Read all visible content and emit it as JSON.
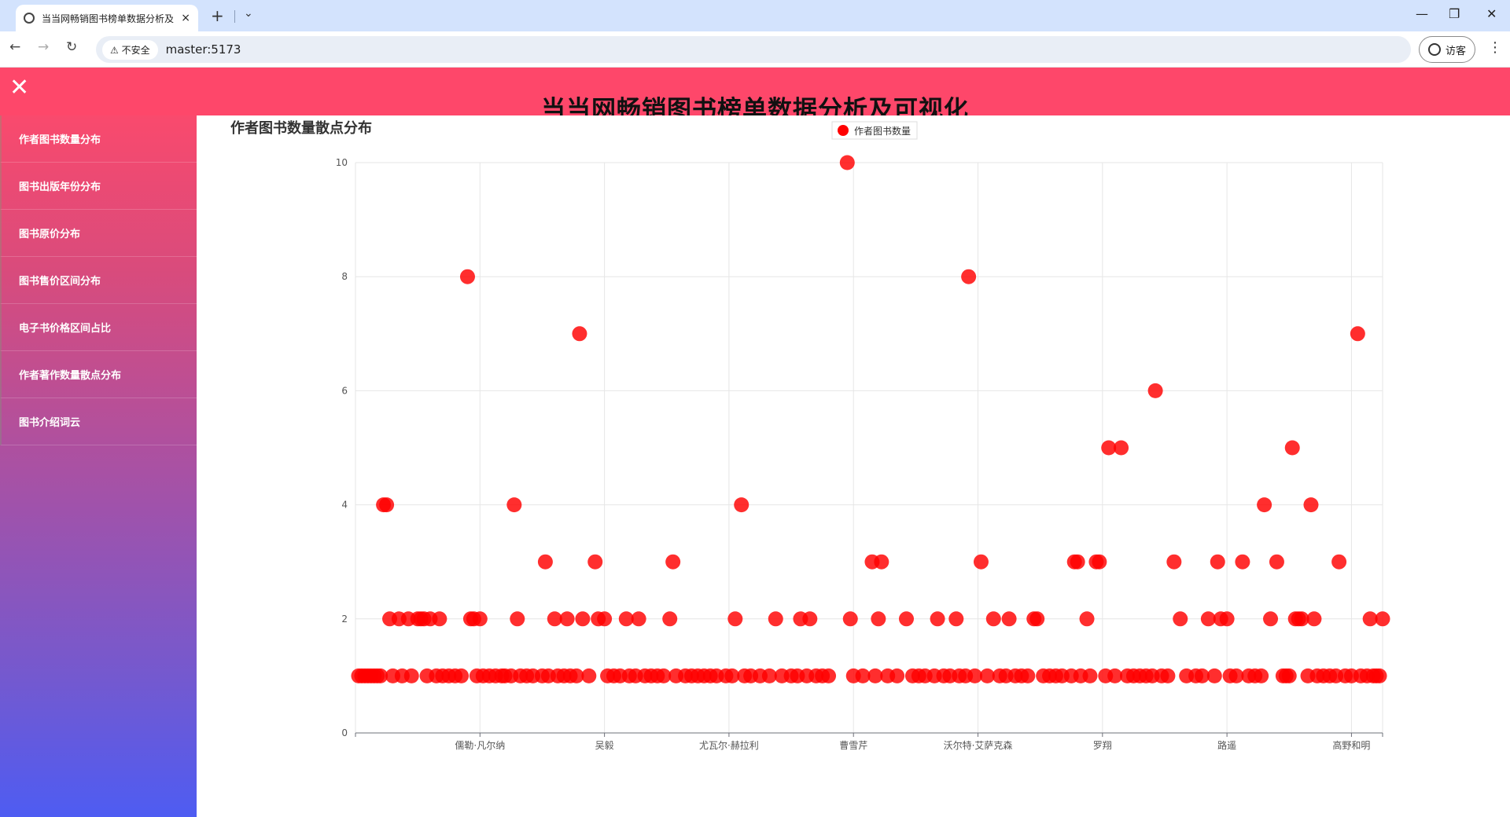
{
  "browser": {
    "tab_title": "当当网畅销图书榜单数据分析及",
    "tab_close": "×",
    "new_tab": "+",
    "address_secure": "不安全",
    "address_url": "master:5173",
    "profile_label": "访客"
  },
  "app": {
    "title": "当当网畅销图书榜单数据分析及可视化",
    "close_icon": "close-icon"
  },
  "sidebar": {
    "items": [
      {
        "label": "作者图书数量分布"
      },
      {
        "label": "图书出版年份分布"
      },
      {
        "label": "图书原价分布"
      },
      {
        "label": "图书售价区间分布"
      },
      {
        "label": "电子书价格区间占比"
      },
      {
        "label": "作者著作数量散点分布"
      },
      {
        "label": "图书介绍词云"
      }
    ]
  },
  "chart_heading": "作者图书数量散点分布",
  "colors": {
    "point": "#ff0000",
    "header": "#fe476a"
  },
  "chart_data": {
    "type": "scatter",
    "legend": [
      "作者图书数量"
    ],
    "legend_position": "top-center",
    "x_labels": [
      "儒勒·凡尔纳",
      "吴毅",
      "尤瓦尔·赫拉利",
      "曹雪芹",
      "沃尔特·艾萨克森",
      "罗翔",
      "路遥",
      "高野和明"
    ],
    "x_domain": [
      0,
      330
    ],
    "x_label_positions": [
      40,
      80,
      120,
      160,
      200,
      240,
      280,
      320
    ],
    "ylim": [
      0,
      10
    ],
    "yticks": [
      0,
      2,
      4,
      6,
      8,
      10
    ],
    "grid": true,
    "series": [
      {
        "name": "作者图书数量",
        "points": [
          [
            1,
            1
          ],
          [
            2,
            1
          ],
          [
            3,
            1
          ],
          [
            4,
            1
          ],
          [
            5,
            1
          ],
          [
            6,
            1
          ],
          [
            7,
            1
          ],
          [
            8,
            1
          ],
          [
            9,
            4
          ],
          [
            10,
            4
          ],
          [
            11,
            2
          ],
          [
            12,
            1
          ],
          [
            14,
            2
          ],
          [
            15,
            1
          ],
          [
            17,
            2
          ],
          [
            18,
            1
          ],
          [
            20,
            2
          ],
          [
            21,
            2
          ],
          [
            22,
            2
          ],
          [
            23,
            1
          ],
          [
            24,
            2
          ],
          [
            26,
            1
          ],
          [
            27,
            2
          ],
          [
            28,
            1
          ],
          [
            30,
            1
          ],
          [
            32,
            1
          ],
          [
            34,
            1
          ],
          [
            36,
            8
          ],
          [
            37,
            2
          ],
          [
            38,
            2
          ],
          [
            39,
            1
          ],
          [
            40,
            2
          ],
          [
            41,
            1
          ],
          [
            43,
            1
          ],
          [
            45,
            1
          ],
          [
            47,
            1
          ],
          [
            48,
            1
          ],
          [
            50,
            1
          ],
          [
            51,
            4
          ],
          [
            52,
            2
          ],
          [
            53,
            1
          ],
          [
            55,
            1
          ],
          [
            57,
            1
          ],
          [
            60,
            1
          ],
          [
            61,
            3
          ],
          [
            62,
            1
          ],
          [
            64,
            2
          ],
          [
            65,
            1
          ],
          [
            67,
            1
          ],
          [
            68,
            2
          ],
          [
            69,
            1
          ],
          [
            71,
            1
          ],
          [
            72,
            7
          ],
          [
            73,
            2
          ],
          [
            75,
            1
          ],
          [
            77,
            3
          ],
          [
            78,
            2
          ],
          [
            80,
            2
          ],
          [
            81,
            1
          ],
          [
            83,
            1
          ],
          [
            85,
            1
          ],
          [
            87,
            2
          ],
          [
            88,
            1
          ],
          [
            90,
            1
          ],
          [
            91,
            2
          ],
          [
            93,
            1
          ],
          [
            95,
            1
          ],
          [
            97,
            1
          ],
          [
            99,
            1
          ],
          [
            101,
            2
          ],
          [
            102,
            3
          ],
          [
            103,
            1
          ],
          [
            106,
            1
          ],
          [
            108,
            1
          ],
          [
            110,
            1
          ],
          [
            112,
            1
          ],
          [
            114,
            1
          ],
          [
            116,
            1
          ],
          [
            119,
            1
          ],
          [
            121,
            1
          ],
          [
            122,
            2
          ],
          [
            124,
            4
          ],
          [
            125,
            1
          ],
          [
            127,
            1
          ],
          [
            130,
            1
          ],
          [
            133,
            1
          ],
          [
            135,
            2
          ],
          [
            137,
            1
          ],
          [
            140,
            1
          ],
          [
            142,
            1
          ],
          [
            143,
            2
          ],
          [
            145,
            1
          ],
          [
            146,
            2
          ],
          [
            148,
            1
          ],
          [
            150,
            1
          ],
          [
            152,
            1
          ],
          [
            158,
            10
          ],
          [
            159,
            2
          ],
          [
            160,
            1
          ],
          [
            163,
            1
          ],
          [
            166,
            3
          ],
          [
            167,
            1
          ],
          [
            168,
            2
          ],
          [
            169,
            3
          ],
          [
            171,
            1
          ],
          [
            174,
            1
          ],
          [
            177,
            2
          ],
          [
            179,
            1
          ],
          [
            181,
            1
          ],
          [
            183,
            1
          ],
          [
            186,
            1
          ],
          [
            187,
            2
          ],
          [
            189,
            1
          ],
          [
            191,
            1
          ],
          [
            193,
            2
          ],
          [
            194,
            1
          ],
          [
            196,
            1
          ],
          [
            197,
            8
          ],
          [
            199,
            1
          ],
          [
            201,
            3
          ],
          [
            203,
            1
          ],
          [
            205,
            2
          ],
          [
            207,
            1
          ],
          [
            209,
            1
          ],
          [
            210,
            2
          ],
          [
            212,
            1
          ],
          [
            214,
            1
          ],
          [
            216,
            1
          ],
          [
            218,
            2
          ],
          [
            219,
            2
          ],
          [
            221,
            1
          ],
          [
            223,
            1
          ],
          [
            225,
            1
          ],
          [
            227,
            1
          ],
          [
            230,
            1
          ],
          [
            231,
            3
          ],
          [
            232,
            3
          ],
          [
            233,
            1
          ],
          [
            235,
            2
          ],
          [
            236,
            1
          ],
          [
            238,
            3
          ],
          [
            239,
            3
          ],
          [
            241,
            1
          ],
          [
            242,
            5
          ],
          [
            244,
            1
          ],
          [
            246,
            5
          ],
          [
            248,
            1
          ],
          [
            250,
            1
          ],
          [
            252,
            1
          ],
          [
            254,
            1
          ],
          [
            256,
            1
          ],
          [
            257,
            6
          ],
          [
            259,
            1
          ],
          [
            261,
            1
          ],
          [
            263,
            3
          ],
          [
            265,
            2
          ],
          [
            267,
            1
          ],
          [
            270,
            1
          ],
          [
            272,
            1
          ],
          [
            274,
            2
          ],
          [
            276,
            1
          ],
          [
            277,
            3
          ],
          [
            278,
            2
          ],
          [
            280,
            2
          ],
          [
            281,
            1
          ],
          [
            283,
            1
          ],
          [
            285,
            3
          ],
          [
            287,
            1
          ],
          [
            289,
            1
          ],
          [
            291,
            1
          ],
          [
            292,
            4
          ],
          [
            294,
            2
          ],
          [
            296,
            3
          ],
          [
            298,
            1
          ],
          [
            299,
            1
          ],
          [
            300,
            1
          ],
          [
            301,
            5
          ],
          [
            302,
            2
          ],
          [
            303,
            2
          ],
          [
            304,
            2
          ],
          [
            306,
            1
          ],
          [
            307,
            4
          ],
          [
            308,
            2
          ],
          [
            309,
            1
          ],
          [
            311,
            1
          ],
          [
            313,
            1
          ],
          [
            315,
            1
          ],
          [
            316,
            3
          ],
          [
            318,
            1
          ],
          [
            320,
            1
          ],
          [
            322,
            7
          ],
          [
            323,
            1
          ],
          [
            325,
            1
          ],
          [
            326,
            2
          ],
          [
            327,
            1
          ],
          [
            328,
            1
          ],
          [
            329,
            1
          ],
          [
            330,
            2
          ]
        ]
      }
    ]
  }
}
